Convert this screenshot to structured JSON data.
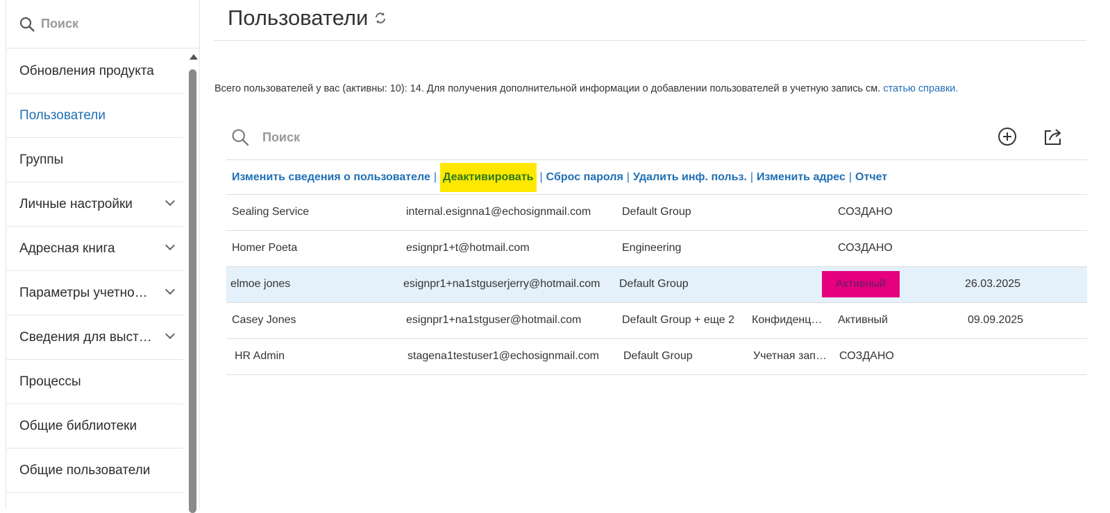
{
  "sidebar": {
    "search_placeholder": "Поиск",
    "items": [
      {
        "label": "Обновления продукта",
        "expand": false
      },
      {
        "label": "Пользователи",
        "expand": false,
        "active": true
      },
      {
        "label": "Группы",
        "expand": false
      },
      {
        "label": "Личные настройки",
        "expand": true
      },
      {
        "label": "Адресная книга",
        "expand": true
      },
      {
        "label": "Параметры учетно…",
        "expand": true
      },
      {
        "label": "Сведения для выст…",
        "expand": true
      },
      {
        "label": "Процессы",
        "expand": false
      },
      {
        "label": "Общие библиотеки",
        "expand": false
      },
      {
        "label": "Общие пользователи",
        "expand": false
      }
    ]
  },
  "header": {
    "title": "Пользователи"
  },
  "info": {
    "text": "Всего пользователей у вас (активны: 10): 14. Для получения дополнительной информации о добавлении пользователей в учетную запись см.",
    "link": "статью справки."
  },
  "search": {
    "placeholder": "Поиск"
  },
  "actions": [
    "Изменить сведения о пользователе",
    "Деактивировать",
    "Сброс пароля",
    "Удалить инф. польз.",
    "Изменить адрес",
    "Отчет"
  ],
  "users": [
    {
      "name": "Sealing Service",
      "email": "internal.esignna1@echosignmail.com",
      "group": "Default Group",
      "extra": "",
      "status": "СОЗДАНО",
      "date": ""
    },
    {
      "name": "Homer Poeta",
      "email": "esignpr1+t@hotmail.com",
      "group": "Engineering",
      "extra": "",
      "status": "СОЗДАНО",
      "date": ""
    },
    {
      "name": "elmoe jones",
      "email": "esignpr1+na1stguserjerry@hotmail.com",
      "group": "Default Group",
      "extra": "",
      "status": "Активный",
      "date": "26.03.2025",
      "selected": true
    },
    {
      "name": "Casey Jones",
      "email": "esignpr1+na1stguser@hotmail.com",
      "group": "Default Group + еще 2",
      "extra": "Конфиденц…",
      "status": "Активный",
      "date": "09.09.2025"
    },
    {
      "name": "HR Admin",
      "email": "stagena1testuser1@echosignmail.com",
      "group": "Default Group",
      "extra": "Учетная зап…",
      "status": "СОЗДАНО",
      "date": ""
    }
  ]
}
